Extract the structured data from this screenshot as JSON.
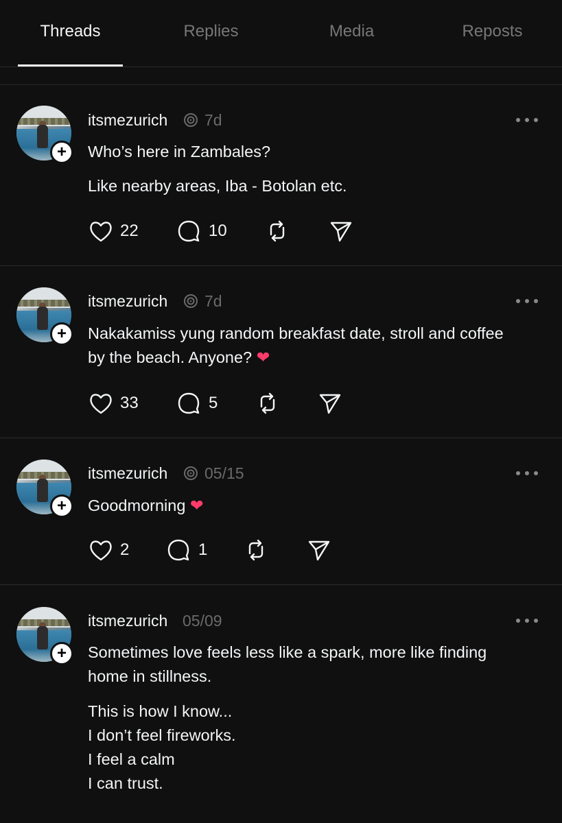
{
  "tabs": [
    {
      "label": "Threads",
      "active": true
    },
    {
      "label": "Replies",
      "active": false
    },
    {
      "label": "Media",
      "active": false
    },
    {
      "label": "Reposts",
      "active": false
    }
  ],
  "posts": [
    {
      "username": "itsmezurich",
      "time": "7d",
      "rethread_icon": true,
      "paragraphs": [
        "Who’s here in Zambales?",
        "Like nearby areas, Iba - Botolan etc."
      ],
      "likes": "22",
      "replies": "10"
    },
    {
      "username": "itsmezurich",
      "time": "7d",
      "rethread_icon": true,
      "paragraphs": [
        "Nakakamiss yung random breakfast date, stroll and coffee\nby the beach. Anyone? ❤"
      ],
      "likes": "33",
      "replies": "5"
    },
    {
      "username": "itsmezurich",
      "time": "05/15",
      "rethread_icon": true,
      "paragraphs": [
        "Goodmorning ❤"
      ],
      "likes": "2",
      "replies": "1"
    },
    {
      "username": "itsmezurich",
      "time": "05/09",
      "rethread_icon": false,
      "paragraphs": [
        "Sometimes love feels less like a spark, more like finding\nhome in stillness.",
        "This is how I know...\nI don’t feel fireworks.\nI feel a calm\nI can trust."
      ]
    }
  ],
  "icons": {
    "like": "heart-outline-icon",
    "reply": "comment-bubble-icon",
    "repost": "repost-icon",
    "share": "send-icon",
    "more": "more-dots-icon",
    "follow": "plus-icon"
  },
  "colors": {
    "background": "#101010",
    "text": "#f3f5f7",
    "muted": "#6a6a6a",
    "heart": "#ff3b6b"
  }
}
